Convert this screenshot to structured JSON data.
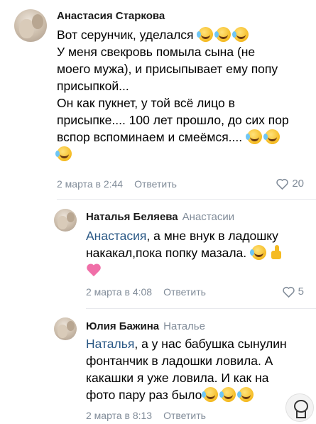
{
  "comments": [
    {
      "author": "Анастасия Старкова",
      "reply_to": "",
      "lines": {
        "l1": "Вот серунчик, уделался",
        "l2": "У меня свекровь помыла сына (не",
        "l3": "моего мужа), и присыпывает ему попу",
        "l4": "присыпкой...",
        "l5": "Он как пукнет, у той всё лицо в",
        "l6": "присыпке.... 100 лет прошло, до сих пор",
        "l7": "вспор вспоминаем и смеёмся...."
      },
      "date": "2 марта в 2:44",
      "reply_label": "Ответить",
      "likes": "20"
    },
    {
      "author": "Наталья Беляева",
      "reply_to": "Анастасии",
      "mention": "Анастасия",
      "lines": {
        "l1": ", а мне внук в ладошку",
        "l2": "накакал,пока попку мазала."
      },
      "date": "2 марта в 4:08",
      "reply_label": "Ответить",
      "likes": "5"
    },
    {
      "author": "Юлия Бажина",
      "reply_to": "Наталье",
      "mention": "Наталья",
      "lines": {
        "l1": ", а у нас бабушка сынулин",
        "l2": "фонтанчик в ладошки ловила. А",
        "l3": "какашки я уже ловила. И как на",
        "l4": "фото пару раз было"
      },
      "date": "2 марта в 8:13",
      "reply_label": "Ответить"
    }
  ],
  "icons": {
    "emoji": "rolling-on-floor-laughing",
    "thumbs": "thumbs-up",
    "heart": "sparkling-heart",
    "like": "heart-outline"
  },
  "colors": {
    "mention": "#2a5885",
    "meta": "#818c99"
  }
}
